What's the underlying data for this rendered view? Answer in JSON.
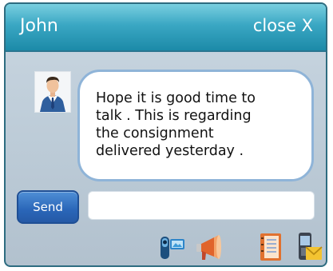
{
  "window": {
    "title": "John",
    "close_label": "close X"
  },
  "conversation": {
    "avatar_icon": "user-avatar-icon",
    "message": "Hope it is good time to talk . This is regarding the consignment delivered yesterday ."
  },
  "compose": {
    "send_label": "Send",
    "input_value": "",
    "input_placeholder": ""
  },
  "toolbar": [
    {
      "name": "video-call-icon"
    },
    {
      "name": "megaphone-icon"
    },
    {
      "name": "notebook-icon"
    },
    {
      "name": "mobile-message-icon"
    }
  ],
  "colors": {
    "titlebar": "#3aa7c3",
    "window_bg": "#c0ced9",
    "bubble_border": "#8fb4d8",
    "send_button": "#2a66b8"
  }
}
